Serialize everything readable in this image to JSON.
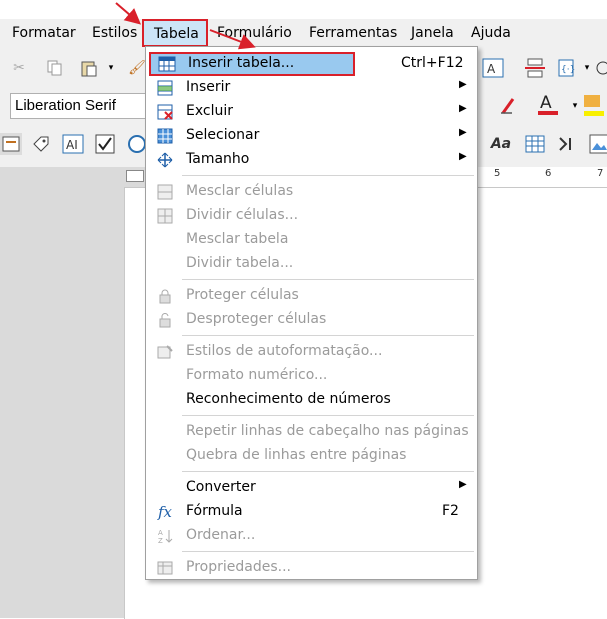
{
  "menubar": {
    "items": [
      "Formatar",
      "Estilos",
      "Tabela",
      "Formulário",
      "Ferramentas",
      "Janela",
      "Ajuda"
    ]
  },
  "toolbar": {
    "font_name": "Liberation Serif"
  },
  "ruler": {
    "marks": [
      "5",
      "6",
      "7"
    ]
  },
  "menu": {
    "items": [
      {
        "label": "Inserir tabela...",
        "shortcut": "Ctrl+F12",
        "icon": "table-icon"
      },
      {
        "label": "Inserir",
        "icon": "insert-rows-icon"
      },
      {
        "label": "Excluir",
        "icon": "delete-table-icon"
      },
      {
        "label": "Selecionar",
        "icon": "select-table-icon"
      },
      {
        "label": "Tamanho",
        "icon": "resize-icon"
      },
      {
        "label": "Mesclar células",
        "icon": "merge-cells-icon"
      },
      {
        "label": "Dividir células...",
        "icon": "split-cells-icon"
      },
      {
        "label": "Mesclar tabela"
      },
      {
        "label": "Dividir tabela..."
      },
      {
        "label": "Proteger células",
        "icon": "lock-icon"
      },
      {
        "label": "Desproteger células",
        "icon": "unlock-icon"
      },
      {
        "label": "Estilos de autoformatação...",
        "icon": "autoformat-icon"
      },
      {
        "label": "Formato numérico..."
      },
      {
        "label": "Reconhecimento de números"
      },
      {
        "label": "Repetir linhas de cabeçalho nas páginas"
      },
      {
        "label": "Quebra de linhas entre páginas"
      },
      {
        "label": "Converter"
      },
      {
        "label": "Fórmula",
        "shortcut": "F2",
        "icon": "formula-icon"
      },
      {
        "label": "Ordenar...",
        "icon": "sort-icon"
      },
      {
        "label": "Propriedades...",
        "icon": "properties-icon"
      }
    ]
  },
  "colors": {
    "highlight": "#99c9ef",
    "annotation_red": "#d9202a",
    "disabled_text": "#9b9b9b"
  }
}
